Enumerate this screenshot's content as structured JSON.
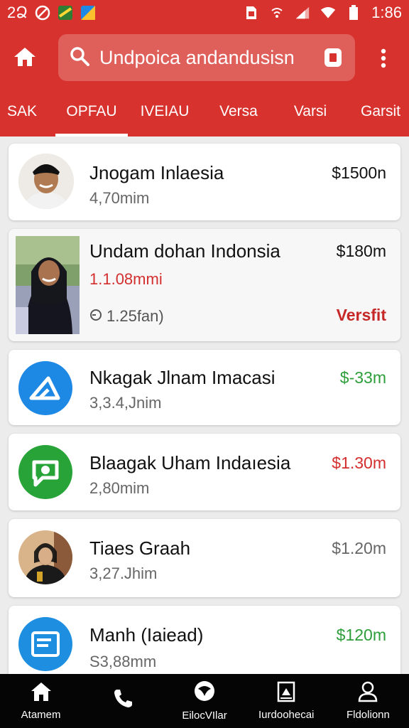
{
  "status_bar": {
    "left_text": "2Ձ",
    "time": "1:86",
    "icons": [
      "no-sign-icon",
      "app-icon",
      "maps-icon",
      "sim-icon",
      "wifi-calling-icon",
      "signal-icon",
      "wifi-icon",
      "battery-icon"
    ]
  },
  "app_bar": {
    "search_text": "Undpoica andandusisn",
    "icons": [
      "home-icon",
      "search-icon",
      "scan-icon",
      "more-vertical-icon"
    ]
  },
  "tabs": [
    "SAK",
    "OPFAU",
    "IVEIAU",
    "Versa",
    "Varsi",
    "Garsit"
  ],
  "active_tab": 1,
  "list": [
    {
      "title": "Jnogam Inlaesia",
      "subtitle": "4,70mim",
      "amount": "$1500n",
      "amount_color": "#111111"
    },
    {
      "title": "Undam dohan Indonsia",
      "subtitle": "1.1.08mmi",
      "meta": "1.25fan)",
      "amount": "$180m",
      "amount_color": "#111111",
      "status": "Versfit",
      "subtitle_color": "#d32f2f",
      "status_color": "#c62828"
    },
    {
      "title": "Nkagak Jlnam Imacasi",
      "subtitle": "3,3.4,Jnim",
      "amount": "$-33m",
      "amount_color": "#2e9e3a",
      "icon": "send-icon",
      "icon_color": "#1e88e5"
    },
    {
      "title": "Blaagak Uham Indaıesia",
      "subtitle": "2,80mim",
      "amount": "$1.30m",
      "amount_color": "#d32f2f",
      "icon": "chat-icon",
      "icon_color": "#27a338"
    },
    {
      "title": "Tiaes Graah",
      "subtitle": "3,27.Jhim",
      "amount": "$1.20m",
      "amount_color": "#666666"
    },
    {
      "title": "Manh  (Iaiead)",
      "subtitle": "S3,88mm",
      "amount": "$120m",
      "amount_color": "#2e9e3a",
      "icon": "document-icon",
      "icon_color": "#1e8fe0"
    }
  ],
  "bottom_nav": [
    {
      "label": "Atamem",
      "icon": "home-icon"
    },
    {
      "label": "",
      "icon": "phone-icon"
    },
    {
      "label": "EilocVIlar",
      "icon": "chat-bubble-icon"
    },
    {
      "label": "Iurdoohecai",
      "icon": "bank-icon"
    },
    {
      "label": "Fldolionn",
      "icon": "profile-icon"
    }
  ]
}
